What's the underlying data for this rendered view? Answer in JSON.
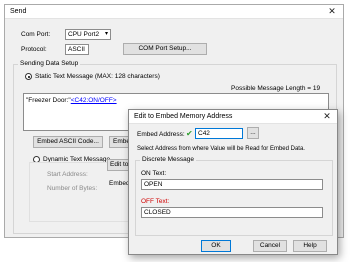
{
  "send_window": {
    "title": "Send",
    "com_port_label": "Com Port:",
    "com_port_value": "CPU Port2",
    "protocol_label": "Protocol:",
    "protocol_value": "ASCII",
    "com_port_setup_label": "COM Port Setup...",
    "sending_group_label": "Sending Data Setup",
    "static_radio_label": "Static Text Message (MAX: 128 characters)",
    "possible_length": "Possible Message Length = 19",
    "message_prefix": "\"Freezer Door:\"",
    "message_link": "<C42:ON/OFF>",
    "embed_ascii_label": "Embed ASCII Code...",
    "embed_memory_label": "Embed M",
    "dynamic_radio_label": "Dynamic Text Message",
    "start_address_label": "Start Address:",
    "number_of_bytes_label": "Number of Bytes:",
    "edit_embed_partial": "Edit to E",
    "embed_address_partial": "Embed A"
  },
  "dialog": {
    "title": "Edit to Embed Memory Address",
    "embed_address_label": "Embed Address:",
    "embed_address_value": "C42",
    "browse_label": "...",
    "hint": "Select Address from where Value will be Read for Embed Data.",
    "discrete_group_label": "Discrete Message",
    "on_text_label": "ON Text:",
    "on_text_value": "OPEN",
    "off_text_label": "OFF Text:",
    "off_text_value": "CLOSED",
    "ok_label": "OK",
    "cancel_label": "Cancel",
    "help_label": "Help"
  },
  "icons": {
    "close": "close-icon",
    "check": "check-icon",
    "dropdown": "chevron-down-icon"
  },
  "colors": {
    "link": "#0000ff",
    "off_label": "#d00000",
    "check": "#2e9e2e",
    "focus_border": "#0078d7"
  }
}
